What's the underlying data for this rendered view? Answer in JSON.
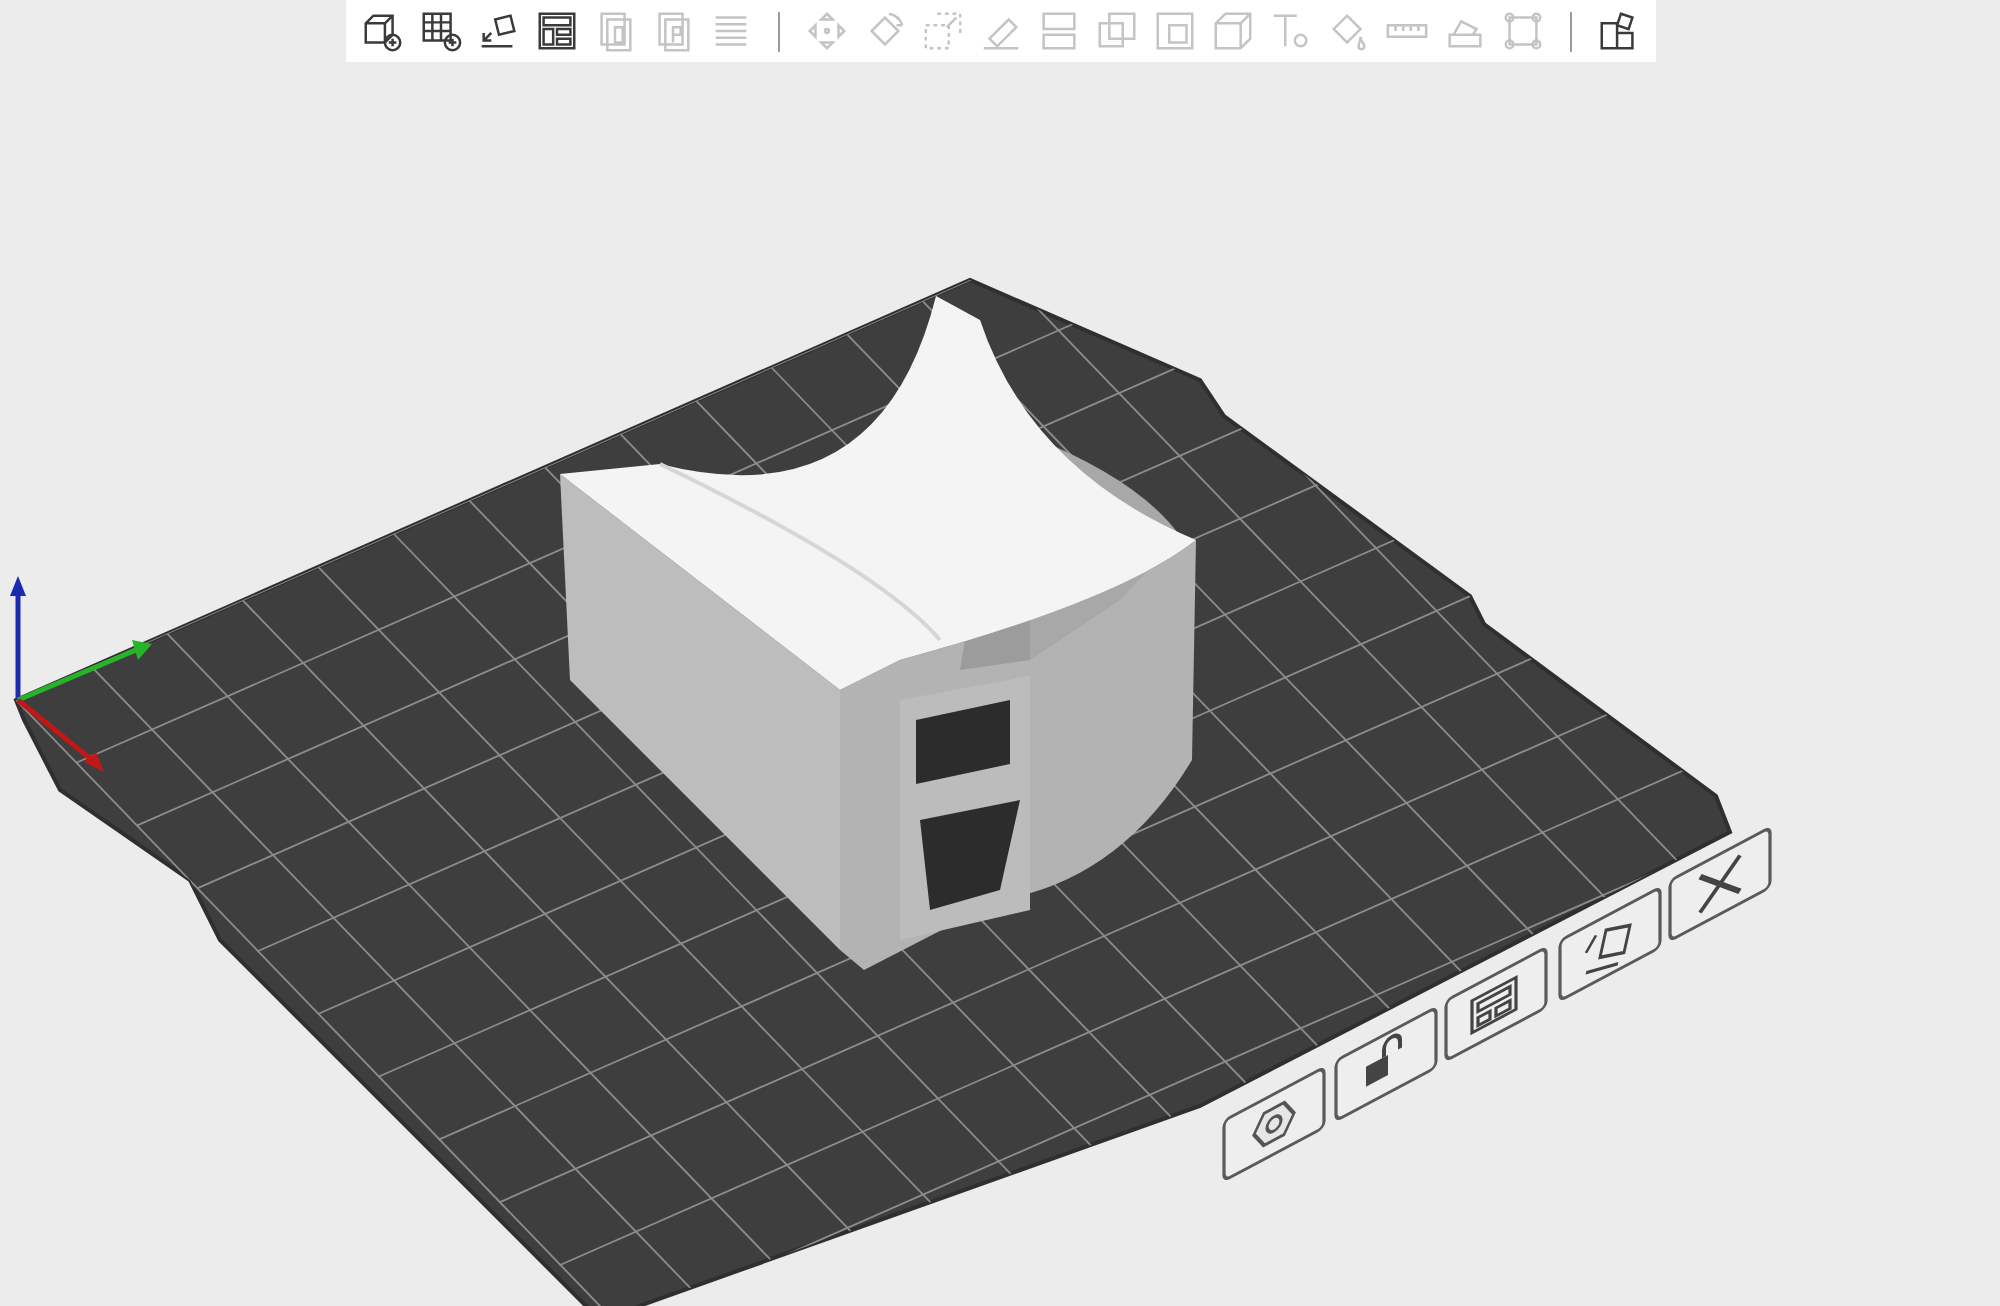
{
  "toolbar": [
    {
      "kind": "tool",
      "disabled": false
    },
    {
      "kind": "tool",
      "disabled": false
    },
    {
      "kind": "tool",
      "disabled": false
    },
    {
      "kind": "tool",
      "disabled": false
    },
    {
      "kind": "tool",
      "disabled": true
    },
    {
      "kind": "tool",
      "disabled": true
    },
    {
      "kind": "tool",
      "disabled": true
    },
    {
      "kind": "separator"
    },
    {
      "kind": "tool",
      "disabled": true
    },
    {
      "kind": "tool",
      "disabled": true
    },
    {
      "kind": "tool",
      "disabled": true
    },
    {
      "kind": "tool",
      "disabled": true
    },
    {
      "kind": "tool",
      "disabled": true
    },
    {
      "kind": "tool",
      "disabled": true
    },
    {
      "kind": "tool",
      "disabled": true
    },
    {
      "kind": "tool",
      "disabled": true
    },
    {
      "kind": "tool",
      "disabled": true
    },
    {
      "kind": "tool",
      "disabled": true
    },
    {
      "kind": "tool",
      "disabled": true
    },
    {
      "kind": "tool",
      "disabled": true
    },
    {
      "kind": "tool",
      "disabled": true
    },
    {
      "kind": "separator"
    },
    {
      "kind": "tool",
      "disabled": false
    }
  ]
}
